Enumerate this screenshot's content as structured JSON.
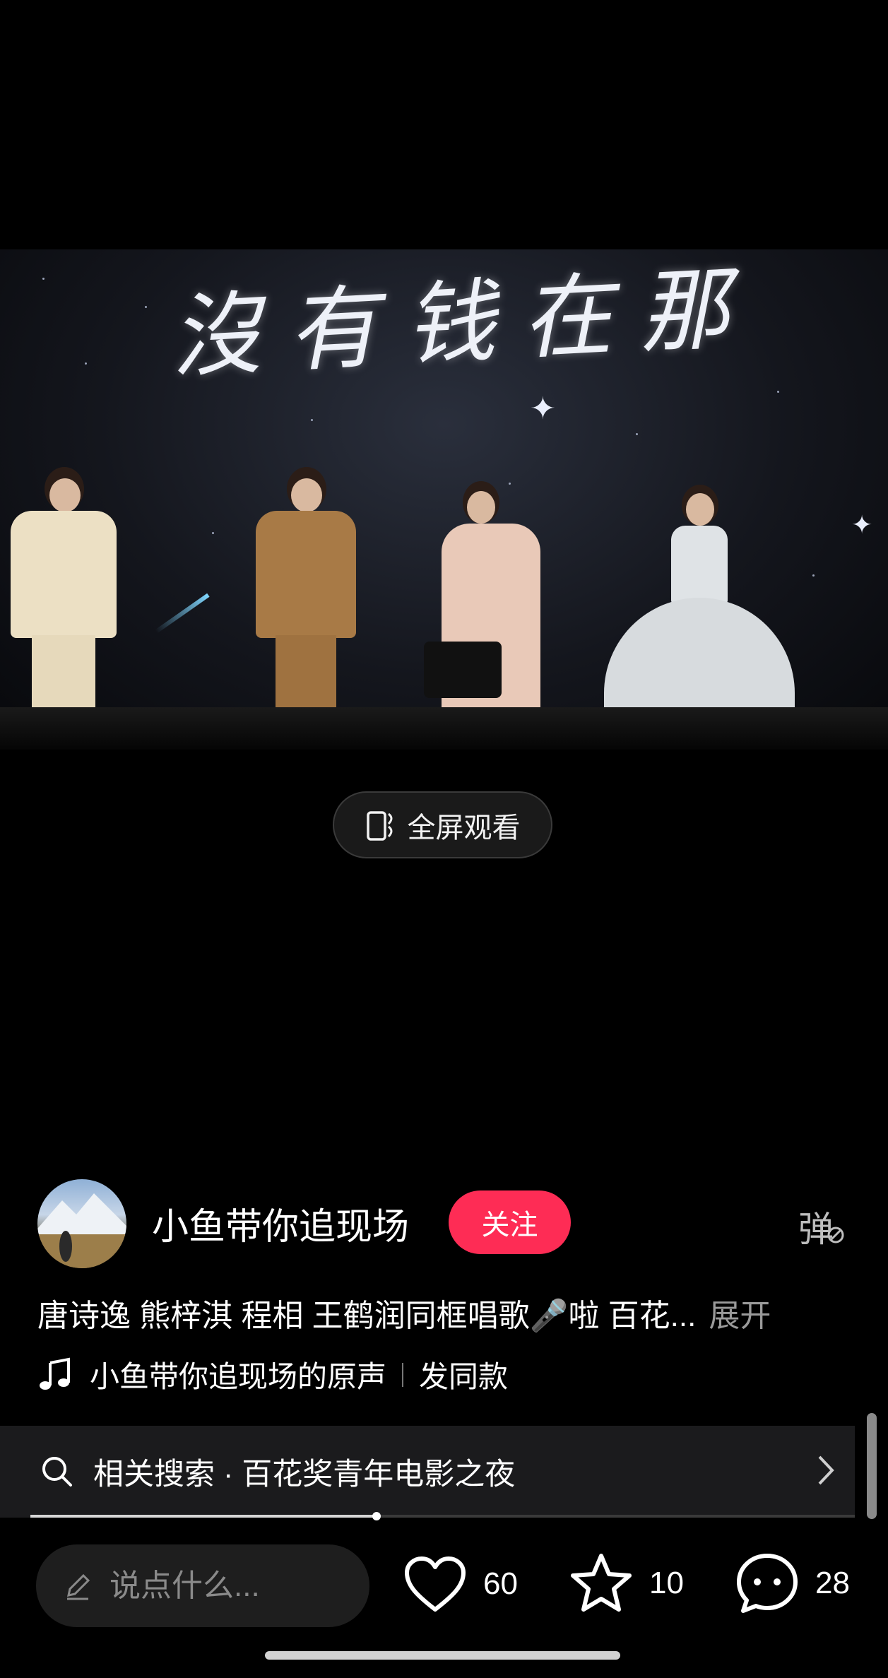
{
  "video": {
    "overlay_text": "沒有钱在那",
    "fullscreen_label": "全屏观看"
  },
  "author": {
    "name": "小鱼带你追现场",
    "follow_label": "关注",
    "danmu_label": "弹"
  },
  "description": {
    "text": "唐诗逸 熊梓淇 程相 王鹤润同框唱歌🎤啦 百花...",
    "expand_label": "展开"
  },
  "music": {
    "title": "小鱼带你追现场的原声",
    "use_sound_label": "发同款"
  },
  "related_search": {
    "label": "相关搜索 · 百花奖青年电影之夜"
  },
  "playback": {
    "progress_fraction": 0.42
  },
  "bottom_bar": {
    "comment_placeholder": "说点什么...",
    "likes": "60",
    "favorites": "10",
    "comments": "28"
  },
  "colors": {
    "accent": "#fe2c55",
    "background": "#000000"
  }
}
